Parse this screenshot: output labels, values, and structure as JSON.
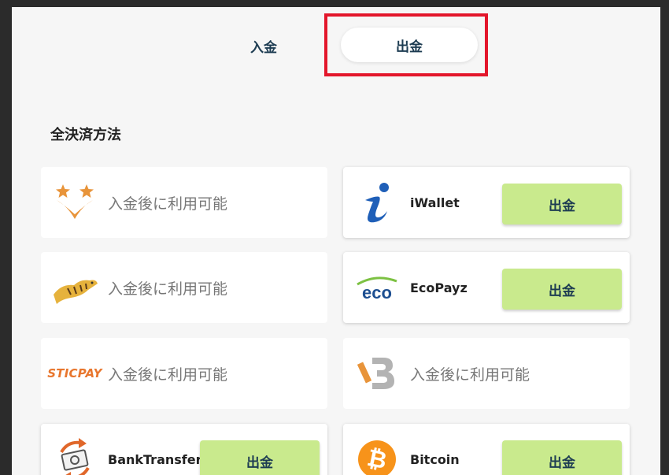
{
  "tabs": {
    "deposit": "入金",
    "withdraw": "出金"
  },
  "section_title": "全決済方法",
  "methods": [
    {
      "name": "",
      "logo": "star-v-logo-icon",
      "status": "入金後に利用可能",
      "button": ""
    },
    {
      "name": "iWallet",
      "logo": "iwallet-logo-icon",
      "status": "",
      "button": "出金"
    },
    {
      "name": "",
      "logo": "tiger-logo-icon",
      "status": "入金後に利用可能",
      "button": ""
    },
    {
      "name": "EcoPayz",
      "logo": "ecopayz-logo-icon",
      "status": "",
      "button": "出金",
      "logo_text": "eco"
    },
    {
      "name": "",
      "logo": "sticpay-logo-icon",
      "status": "入金後に利用可能",
      "button": "",
      "logo_text": "STICPAY"
    },
    {
      "name": "",
      "logo": "bitwallet-logo-icon",
      "status": "入金後に利用可能",
      "button": ""
    },
    {
      "name": "BankTransfer",
      "logo": "bank-transfer-icon",
      "status": "",
      "button": "出金"
    },
    {
      "name": "Bitcoin",
      "logo": "bitcoin-logo-icon",
      "status": "",
      "button": "出金"
    }
  ],
  "colors": {
    "highlight": "#e3162b",
    "button_bg": "#c9ea8d",
    "text_dark": "#1d3c52"
  }
}
